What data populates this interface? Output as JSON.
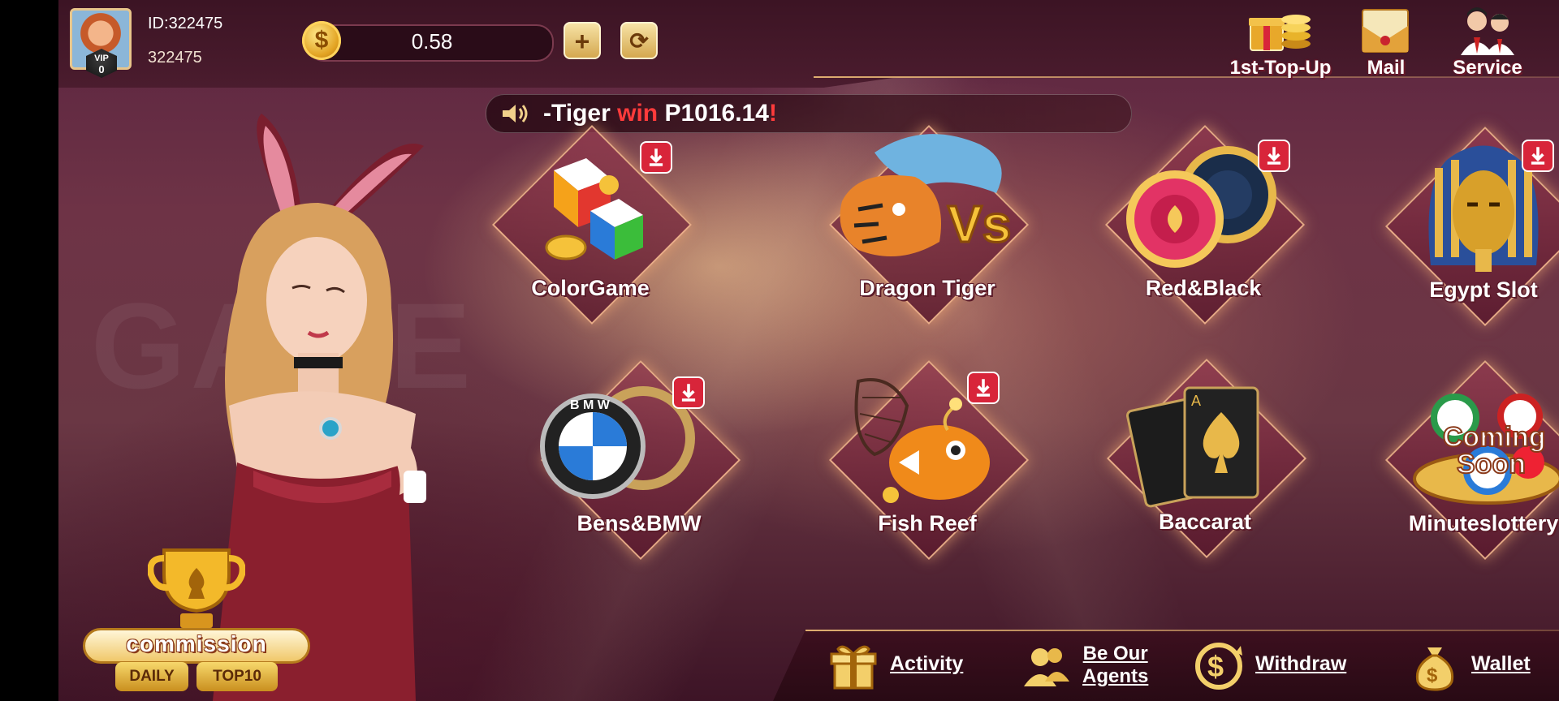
{
  "user": {
    "id_label": "ID:",
    "id": "322475",
    "number": "322475",
    "vip_label": "VIP",
    "vip_level": "0"
  },
  "balance": {
    "value": "0.58",
    "coin_symbol": "$",
    "add_label": "+",
    "refresh_label": "⟳"
  },
  "top_actions": [
    {
      "label": "1st-Top-Up",
      "icon": "gift-coins-icon"
    },
    {
      "label": "Mail",
      "icon": "mail-envelope-icon"
    },
    {
      "label": "Service",
      "icon": "service-agents-icon"
    }
  ],
  "marquee": {
    "prefix": "-Tiger ",
    "win": "win",
    "amount": " P1016.14",
    "suffix": "!"
  },
  "games": [
    {
      "label": "ColorGame",
      "icon": "color-dice-icon",
      "downloadable": true
    },
    {
      "label": "Dragon Tiger",
      "icon": "dragon-tiger-icon",
      "downloadable": false
    },
    {
      "label": "Red&Black",
      "icon": "poker-chips-icon",
      "downloadable": true
    },
    {
      "label": "Egypt Slot",
      "icon": "pharaoh-icon",
      "downloadable": true
    },
    {
      "label": "Bens&BMW",
      "icon": "car-logos-icon",
      "downloadable": true
    },
    {
      "label": "Fish Reef",
      "icon": "fish-net-icon",
      "downloadable": true
    },
    {
      "label": "Baccarat",
      "icon": "playing-cards-icon",
      "downloadable": false
    },
    {
      "label": "Minuteslottery",
      "icon": "lottery-balls-icon",
      "downloadable": false,
      "overlay": "Coming\nSoon"
    }
  ],
  "commission": {
    "title": "commission",
    "daily": "DAILY",
    "top": "TOP10"
  },
  "bottom_nav": [
    {
      "label": "Activity",
      "icon": "gift-box-icon"
    },
    {
      "label_line1": "Be Our",
      "label_line2": "Agents",
      "icon": "agents-icon"
    },
    {
      "label": "Withdraw",
      "icon": "withdraw-coin-icon"
    },
    {
      "label": "Wallet",
      "icon": "money-bag-icon"
    }
  ],
  "colors": {
    "accent_gold": "#e8c58b",
    "download_red": "#d8253a",
    "win_red": "#ff3b3b",
    "bg_dark": "#3c1424"
  }
}
